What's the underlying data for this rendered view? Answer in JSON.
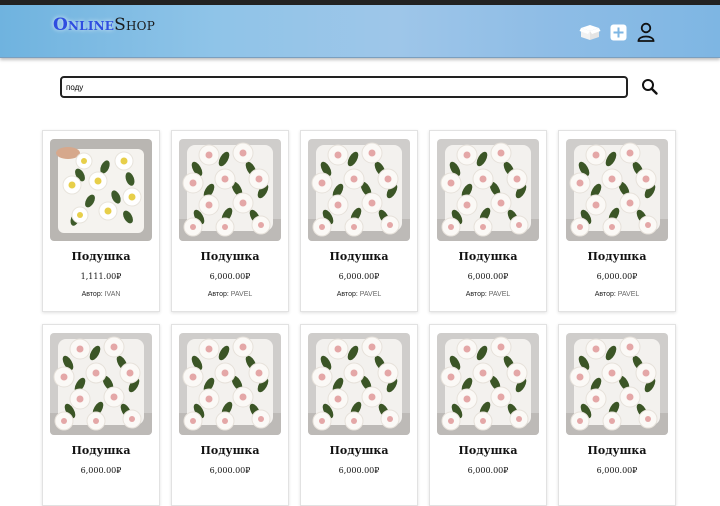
{
  "header": {
    "logo_part1": "Online",
    "logo_part2": "Shop",
    "icons": [
      "box-icon",
      "add-icon",
      "user-icon"
    ]
  },
  "search": {
    "value": "поду",
    "button_icon": "search-icon"
  },
  "colors": {
    "header_start": "#6fb3df",
    "header_end": "#7eb6e3",
    "logo_accent": "#2f4ee0"
  },
  "products": [
    {
      "title": "Подушка",
      "price": "1,111.00₽",
      "author_label": "Автор:",
      "author": "IVAN",
      "image": "pillow-yellow"
    },
    {
      "title": "Подушка",
      "price": "6,000.00₽",
      "author_label": "Автор:",
      "author": "PAVEL",
      "image": "pillow-pink"
    },
    {
      "title": "Подушка",
      "price": "6,000.00₽",
      "author_label": "Автор:",
      "author": "PAVEL",
      "image": "pillow-pink"
    },
    {
      "title": "Подушка",
      "price": "6,000.00₽",
      "author_label": "Автор:",
      "author": "PAVEL",
      "image": "pillow-pink"
    },
    {
      "title": "Подушка",
      "price": "6,000.00₽",
      "author_label": "Автор:",
      "author": "PAVEL",
      "image": "pillow-pink"
    },
    {
      "title": "Подушка",
      "price": "6,000.00₽",
      "author_label": "",
      "author": "",
      "image": "pillow-pink"
    },
    {
      "title": "Подушка",
      "price": "6,000.00₽",
      "author_label": "",
      "author": "",
      "image": "pillow-pink"
    },
    {
      "title": "Подушка",
      "price": "6,000.00₽",
      "author_label": "",
      "author": "",
      "image": "pillow-pink"
    },
    {
      "title": "Подушка",
      "price": "6,000.00₽",
      "author_label": "",
      "author": "",
      "image": "pillow-pink"
    },
    {
      "title": "Подушка",
      "price": "6,000.00₽",
      "author_label": "",
      "author": "",
      "image": "pillow-pink"
    }
  ]
}
